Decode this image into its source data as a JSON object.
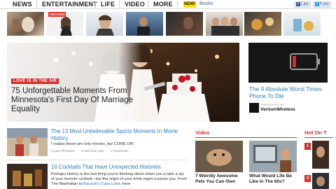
{
  "nav": {
    "items": [
      "NEWS",
      "ENTERTAINMENT",
      "LIFE",
      "VIDEO",
      "MORE"
    ],
    "new_badge": "NEW!",
    "books": "Books",
    "like_label": "Like",
    "follow_label": "Follo"
  },
  "thumb_strip": {
    "first_badge": "FEATURED"
  },
  "hero": {
    "tag": "LOVE IS IN THE AIR",
    "title": "75 Unforgettable Moments From Minnesota's First Day Of Marriage Equality"
  },
  "promo": {
    "title": "The 9 Absolute Worst Times Phone To Die",
    "presented_by": "PRESENTED BY",
    "sponsor": "VerizonWireless"
  },
  "articles": [
    {
      "title": "The 13 Most Unbelievable Sports Moments In Movie History",
      "subtitle": "I realize these are only movies, but COME ON!",
      "author": "Logan Rhoades",
      "time": "a half hour ago",
      "responses": "1 responses"
    },
    {
      "title": "10 Cocktails That Have Unexpected Histories",
      "subtitle_a": "Perhaps history is the last thing you're thinking about when you a take a sip of your favorite cocktail—but the origin of your drink might surprise you. From The Manhattan to ",
      "subtitle_link": "Bacardi's Cuba Libre",
      "subtitle_b": ", here"
    }
  ],
  "video": {
    "heading": "Video",
    "items": [
      {
        "title": "7 Weirdly Awesome Pets You Can Own"
      },
      {
        "title": "What Would Life Be Like In The 60s?"
      }
    ]
  },
  "hot": {
    "heading": "Hot On T",
    "numbers": [
      "1",
      "2"
    ]
  },
  "colors": {
    "link_blue": "#2a7bbf",
    "accent_red": "#d62d2d",
    "badge_yellow": "#ffe100"
  }
}
